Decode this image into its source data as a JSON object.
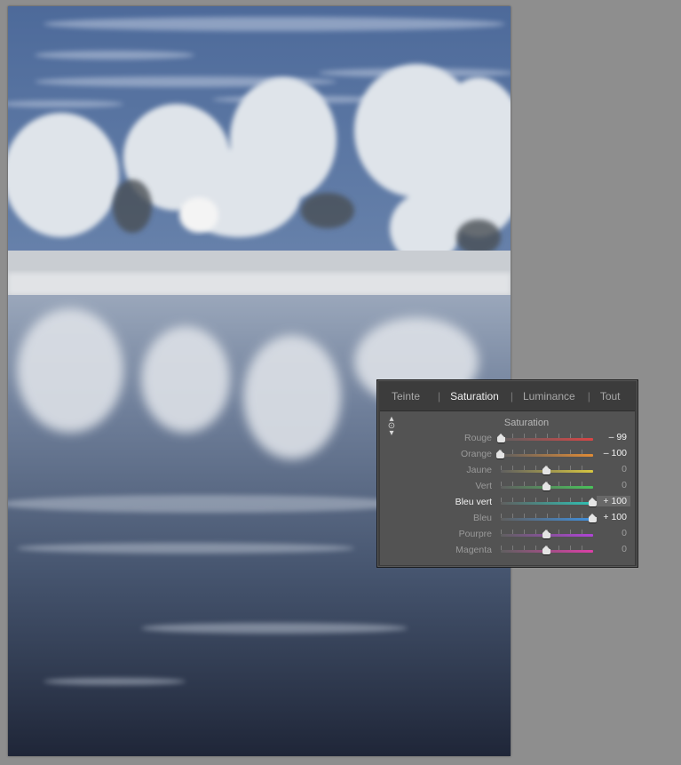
{
  "panel": {
    "tabs": [
      {
        "label": "Teinte",
        "active": false
      },
      {
        "label": "Saturation",
        "active": true
      },
      {
        "label": "Luminance",
        "active": false
      },
      {
        "label": "Tout",
        "active": false
      }
    ],
    "separator": "|",
    "section_title": "Saturation",
    "targeter_icon": "targeted-adjustment-icon",
    "rows": [
      {
        "label": "Rouge",
        "value": "– 99",
        "level": -99,
        "gradient": [
          "#606060",
          "#d84545"
        ]
      },
      {
        "label": "Orange",
        "value": "– 100",
        "level": -100,
        "gradient": [
          "#606060",
          "#e08b35"
        ]
      },
      {
        "label": "Jaune",
        "value": "0",
        "level": 0,
        "gradient": [
          "#606060",
          "#d7c640"
        ]
      },
      {
        "label": "Vert",
        "value": "0",
        "level": 0,
        "gradient": [
          "#606060",
          "#49c25a"
        ]
      },
      {
        "label": "Bleu vert",
        "value": "+ 100",
        "level": 100,
        "gradient": [
          "#606060",
          "#2fc1b4"
        ],
        "highlight": true
      },
      {
        "label": "Bleu",
        "value": "+ 100",
        "level": 100,
        "gradient": [
          "#606060",
          "#3f8fdd"
        ]
      },
      {
        "label": "Pourpre",
        "value": "0",
        "level": 0,
        "gradient": [
          "#606060",
          "#b043d6"
        ]
      },
      {
        "label": "Magenta",
        "value": "0",
        "level": 0,
        "gradient": [
          "#606060",
          "#dd3fa8"
        ]
      }
    ]
  }
}
